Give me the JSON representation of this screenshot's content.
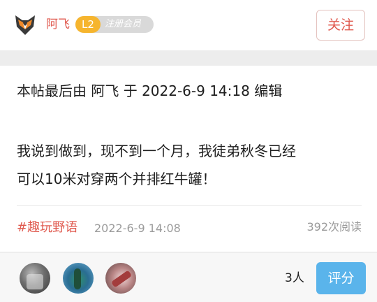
{
  "header": {
    "author_name": "阿飞",
    "level_badge": "L2",
    "member_label": "注册会员",
    "follow_label": "关注",
    "logo_icon": "fox-logo-icon"
  },
  "post": {
    "edit_note": "本帖最后由 阿飞 于 2022-6-9 14:18 编辑",
    "content_line1": "我说到做到，现不到一个月，我徒弟秋冬已经",
    "content_line2": "可以10米对穿两个并排红牛罐！",
    "tag": "#趣玩野语",
    "date": "2022-6-9 14:08",
    "views": "392次阅读"
  },
  "rating": {
    "rater_count": "3人",
    "rate_label": "评分"
  },
  "colors": {
    "accent_red": "#e05a4f",
    "level_gold": "#f6b52e",
    "rate_blue": "#5ab4eb"
  }
}
